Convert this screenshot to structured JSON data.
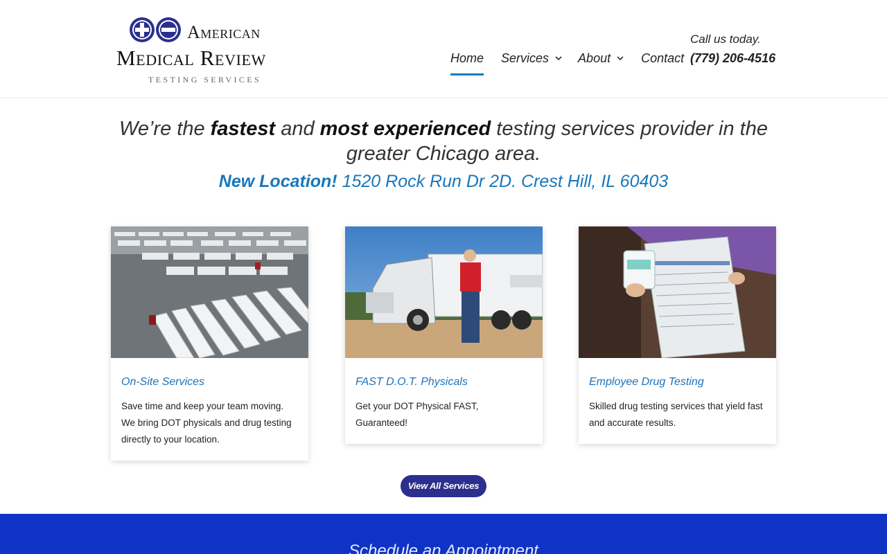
{
  "brand": {
    "line1": "American",
    "line2": "Medical Review",
    "line3": "TESTING SERVICES",
    "colors": {
      "plus_icon": "#2a2f8f",
      "minus_icon": "#2a2f8f"
    }
  },
  "nav": {
    "items": [
      {
        "label": "Home",
        "active": true,
        "dropdown": false
      },
      {
        "label": "Services",
        "active": false,
        "dropdown": true
      },
      {
        "label": "About",
        "active": false,
        "dropdown": true
      },
      {
        "label": "Contact",
        "active": false,
        "dropdown": false
      }
    ],
    "chevron_glyph": "⌄"
  },
  "contact": {
    "call_text": "Call us today.",
    "phone": "(779) 206-4516"
  },
  "hero": {
    "part1": "We’re the ",
    "bold1": "fastest",
    "part2": " and ",
    "bold2": "most experienced",
    "part3": " testing services provider in the greater Chicago area.",
    "location_label": "New Location!",
    "location_address": " 1520 Rock Run Dr 2D. Crest Hill, IL 60403"
  },
  "cards": [
    {
      "title": "On-Site Services",
      "text": "Save time and keep your team moving. We bring DOT physicals and drug testing directly to your location.",
      "image": "truck-lot-photo"
    },
    {
      "title": "FAST D.O.T. Physicals",
      "text": "Get your DOT Physical FAST, Guaranteed!",
      "image": "truck-driver-photo"
    },
    {
      "title": "Employee Drug Testing",
      "text": "Skilled drug testing services that yield fast and accurate results.",
      "image": "drug-test-form-photo"
    }
  ],
  "cta": {
    "label": "View All Services"
  },
  "footer": {
    "heading": "Schedule an Appointment"
  },
  "colors": {
    "accent_blue": "#1777bc",
    "button_navy": "#2c2f8e",
    "band_blue": "#0f33c4"
  }
}
